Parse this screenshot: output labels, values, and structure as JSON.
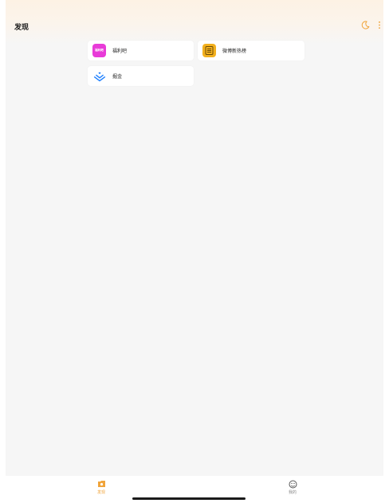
{
  "header": {
    "title": "发现",
    "accent_color": "#f0a43a"
  },
  "grid": {
    "items": [
      {
        "label": "福利吧",
        "logo_text": "福利吧",
        "icon": "fuliba-logo-icon",
        "logo_color": "#e83bd8"
      },
      {
        "label": "微博新热榜",
        "icon": "weibo-hot-list-icon",
        "logo_color": "#f2b01e"
      },
      {
        "label": "掘金",
        "icon": "juejin-logo-icon",
        "logo_color": "#1e80ff"
      }
    ]
  },
  "tabbar": {
    "tabs": [
      {
        "label": "发现",
        "icon": "discover-icon",
        "active": true,
        "color": "#f0a43a"
      },
      {
        "label": "我的",
        "icon": "profile-icon",
        "active": false,
        "color": "#8a8a8a"
      }
    ]
  }
}
